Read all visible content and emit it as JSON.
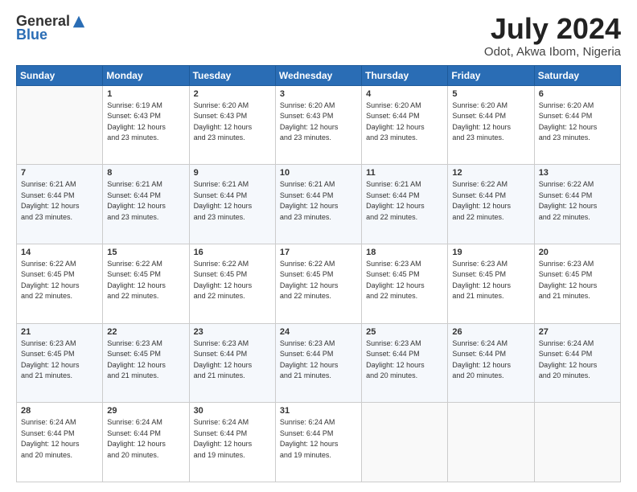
{
  "logo": {
    "general": "General",
    "blue": "Blue"
  },
  "header": {
    "month": "July 2024",
    "location": "Odot, Akwa Ibom, Nigeria"
  },
  "days_of_week": [
    "Sunday",
    "Monday",
    "Tuesday",
    "Wednesday",
    "Thursday",
    "Friday",
    "Saturday"
  ],
  "weeks": [
    [
      {
        "day": "",
        "info": ""
      },
      {
        "day": "1",
        "info": "Sunrise: 6:19 AM\nSunset: 6:43 PM\nDaylight: 12 hours\nand 23 minutes."
      },
      {
        "day": "2",
        "info": "Sunrise: 6:20 AM\nSunset: 6:43 PM\nDaylight: 12 hours\nand 23 minutes."
      },
      {
        "day": "3",
        "info": "Sunrise: 6:20 AM\nSunset: 6:43 PM\nDaylight: 12 hours\nand 23 minutes."
      },
      {
        "day": "4",
        "info": "Sunrise: 6:20 AM\nSunset: 6:44 PM\nDaylight: 12 hours\nand 23 minutes."
      },
      {
        "day": "5",
        "info": "Sunrise: 6:20 AM\nSunset: 6:44 PM\nDaylight: 12 hours\nand 23 minutes."
      },
      {
        "day": "6",
        "info": "Sunrise: 6:20 AM\nSunset: 6:44 PM\nDaylight: 12 hours\nand 23 minutes."
      }
    ],
    [
      {
        "day": "7",
        "info": "Sunrise: 6:21 AM\nSunset: 6:44 PM\nDaylight: 12 hours\nand 23 minutes."
      },
      {
        "day": "8",
        "info": "Sunrise: 6:21 AM\nSunset: 6:44 PM\nDaylight: 12 hours\nand 23 minutes."
      },
      {
        "day": "9",
        "info": "Sunrise: 6:21 AM\nSunset: 6:44 PM\nDaylight: 12 hours\nand 23 minutes."
      },
      {
        "day": "10",
        "info": "Sunrise: 6:21 AM\nSunset: 6:44 PM\nDaylight: 12 hours\nand 23 minutes."
      },
      {
        "day": "11",
        "info": "Sunrise: 6:21 AM\nSunset: 6:44 PM\nDaylight: 12 hours\nand 22 minutes."
      },
      {
        "day": "12",
        "info": "Sunrise: 6:22 AM\nSunset: 6:44 PM\nDaylight: 12 hours\nand 22 minutes."
      },
      {
        "day": "13",
        "info": "Sunrise: 6:22 AM\nSunset: 6:44 PM\nDaylight: 12 hours\nand 22 minutes."
      }
    ],
    [
      {
        "day": "14",
        "info": "Sunrise: 6:22 AM\nSunset: 6:45 PM\nDaylight: 12 hours\nand 22 minutes."
      },
      {
        "day": "15",
        "info": "Sunrise: 6:22 AM\nSunset: 6:45 PM\nDaylight: 12 hours\nand 22 minutes."
      },
      {
        "day": "16",
        "info": "Sunrise: 6:22 AM\nSunset: 6:45 PM\nDaylight: 12 hours\nand 22 minutes."
      },
      {
        "day": "17",
        "info": "Sunrise: 6:22 AM\nSunset: 6:45 PM\nDaylight: 12 hours\nand 22 minutes."
      },
      {
        "day": "18",
        "info": "Sunrise: 6:23 AM\nSunset: 6:45 PM\nDaylight: 12 hours\nand 22 minutes."
      },
      {
        "day": "19",
        "info": "Sunrise: 6:23 AM\nSunset: 6:45 PM\nDaylight: 12 hours\nand 21 minutes."
      },
      {
        "day": "20",
        "info": "Sunrise: 6:23 AM\nSunset: 6:45 PM\nDaylight: 12 hours\nand 21 minutes."
      }
    ],
    [
      {
        "day": "21",
        "info": "Sunrise: 6:23 AM\nSunset: 6:45 PM\nDaylight: 12 hours\nand 21 minutes."
      },
      {
        "day": "22",
        "info": "Sunrise: 6:23 AM\nSunset: 6:45 PM\nDaylight: 12 hours\nand 21 minutes."
      },
      {
        "day": "23",
        "info": "Sunrise: 6:23 AM\nSunset: 6:44 PM\nDaylight: 12 hours\nand 21 minutes."
      },
      {
        "day": "24",
        "info": "Sunrise: 6:23 AM\nSunset: 6:44 PM\nDaylight: 12 hours\nand 21 minutes."
      },
      {
        "day": "25",
        "info": "Sunrise: 6:23 AM\nSunset: 6:44 PM\nDaylight: 12 hours\nand 20 minutes."
      },
      {
        "day": "26",
        "info": "Sunrise: 6:24 AM\nSunset: 6:44 PM\nDaylight: 12 hours\nand 20 minutes."
      },
      {
        "day": "27",
        "info": "Sunrise: 6:24 AM\nSunset: 6:44 PM\nDaylight: 12 hours\nand 20 minutes."
      }
    ],
    [
      {
        "day": "28",
        "info": "Sunrise: 6:24 AM\nSunset: 6:44 PM\nDaylight: 12 hours\nand 20 minutes."
      },
      {
        "day": "29",
        "info": "Sunrise: 6:24 AM\nSunset: 6:44 PM\nDaylight: 12 hours\nand 20 minutes."
      },
      {
        "day": "30",
        "info": "Sunrise: 6:24 AM\nSunset: 6:44 PM\nDaylight: 12 hours\nand 19 minutes."
      },
      {
        "day": "31",
        "info": "Sunrise: 6:24 AM\nSunset: 6:44 PM\nDaylight: 12 hours\nand 19 minutes."
      },
      {
        "day": "",
        "info": ""
      },
      {
        "day": "",
        "info": ""
      },
      {
        "day": "",
        "info": ""
      }
    ]
  ]
}
